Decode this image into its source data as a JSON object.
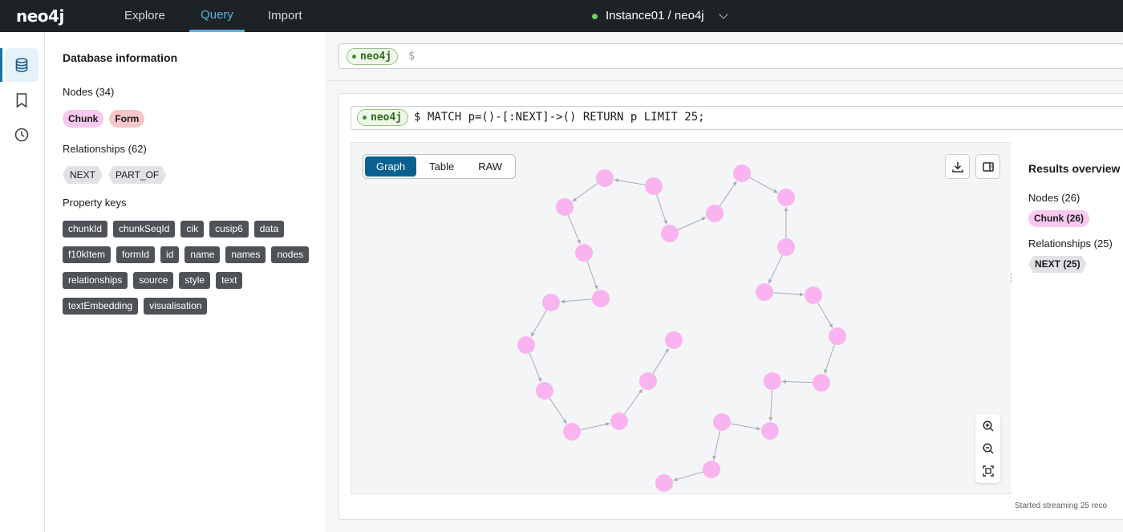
{
  "app": {
    "logo": "neo4j",
    "nav": [
      {
        "label": "Explore",
        "active": false
      },
      {
        "label": "Query",
        "active": true
      },
      {
        "label": "Import",
        "active": false
      }
    ],
    "instance": "Instance01 / neo4j",
    "instance_status_color": "#6fcf5a"
  },
  "rail": {
    "icons": [
      "database-icon",
      "bookmark-icon",
      "history-icon"
    ]
  },
  "db_panel": {
    "title": "Database information",
    "nodes_label": "Nodes (34)",
    "node_labels": [
      {
        "label": "Chunk",
        "color": "#f9c8ee"
      },
      {
        "label": "Form",
        "color": "#f6c6c9"
      }
    ],
    "relationships_label": "Relationships (62)",
    "relationship_types": [
      "NEXT",
      "PART_OF"
    ],
    "property_keys_label": "Property keys",
    "property_keys": [
      "chunkId",
      "chunkSeqId",
      "cik",
      "cusip6",
      "data",
      "f10kItem",
      "formId",
      "id",
      "name",
      "names",
      "nodes",
      "relationships",
      "source",
      "style",
      "text",
      "textEmbedding",
      "visualisation"
    ]
  },
  "editor": {
    "db": "neo4j",
    "prompt": "$"
  },
  "result": {
    "db": "neo4j",
    "prompt": "$",
    "query": "MATCH p=()-[:NEXT]->() RETURN p LIMIT 25;",
    "views": [
      {
        "label": "Graph",
        "active": true
      },
      {
        "label": "Table",
        "active": false
      },
      {
        "label": "RAW",
        "active": false
      }
    ],
    "overview": {
      "title": "Results overview",
      "nodes_label": "Nodes (26)",
      "node_chip": "Chunk (26)",
      "relationships_label": "Relationships (25)",
      "rel_chip": "NEXT (25)"
    },
    "status": "Started streaming 25 reco",
    "node_color": "#f9b4f0",
    "edge_color": "#a5abb6"
  }
}
